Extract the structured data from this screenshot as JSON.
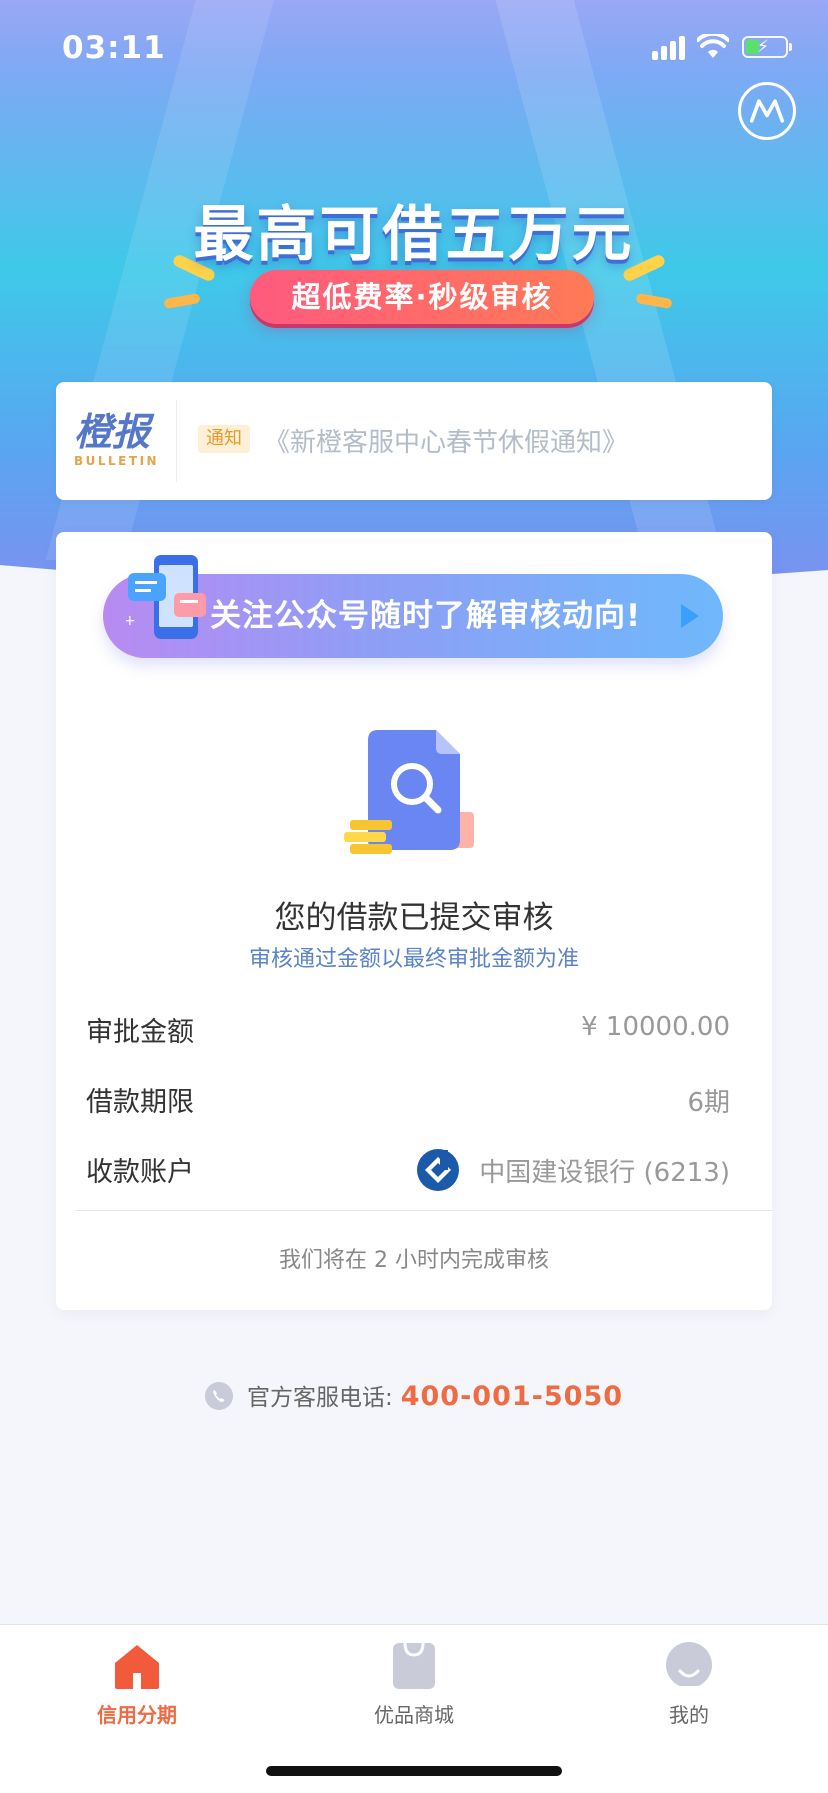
{
  "status_bar": {
    "time": "03:11"
  },
  "hero": {
    "title": "最高可借五万元",
    "subtitle": "超低费率·秒级审核"
  },
  "bulletin": {
    "logo_cn": "橙报",
    "logo_en": "BULLETIN",
    "badge": "通知",
    "text": "《新橙客服中心春节休假通知》"
  },
  "follow_banner": {
    "text": "关注公众号随时了解审核动向!"
  },
  "application": {
    "title": "您的借款已提交审核",
    "subtitle": "审核通过金额以最终审批金额为准",
    "rows": [
      {
        "label": "审批金额",
        "value": "¥ 10000.00"
      },
      {
        "label": "借款期限",
        "value": "6期"
      },
      {
        "label": "收款账户",
        "value": "中国建设银行 (6213)"
      }
    ],
    "footer_note": "我们将在 2 小时内完成审核"
  },
  "hotline": {
    "label": "官方客服电话:",
    "number": "400-001-5050"
  },
  "tabbar": {
    "items": [
      {
        "label": "信用分期",
        "active": true
      },
      {
        "label": "优品商城",
        "active": false
      },
      {
        "label": "我的",
        "active": false
      }
    ]
  },
  "colors": {
    "accent": "#ef6b44",
    "link_blue": "#5b83c7",
    "tab_inactive": "#c9ccd8"
  },
  "icons": [
    "signal-icon",
    "wifi-icon",
    "battery-icon",
    "brand-m-icon",
    "phone-chat-icon",
    "play-icon",
    "document-search-icon",
    "ccb-bank-icon",
    "phone-icon",
    "home-icon",
    "shopping-bag-icon",
    "profile-icon"
  ]
}
